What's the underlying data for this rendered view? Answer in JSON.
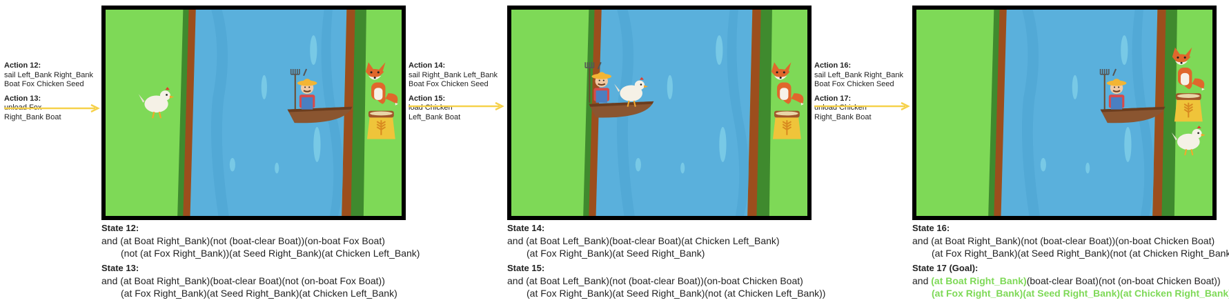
{
  "actions": [
    {
      "title": "Action 12:",
      "text": "sail Left_Bank Right_Bank\nBoat Fox Chicken Seed"
    },
    {
      "title": "Action 13:",
      "text": "unload Fox\nRight_Bank Boat"
    },
    {
      "title": "Action 14:",
      "text": "sail Right_Bank Left_Bank\nBoat Fox Chicken Seed"
    },
    {
      "title": "Action 15:",
      "text": "load Chicken\nLeft_Bank Boat"
    },
    {
      "title": "Action 16:",
      "text": "sail Left_Bank Right_Bank\nBoat Fox Chicken Seed"
    },
    {
      "title": "Action 17:",
      "text": "unload Chicken\nRight_Bank Boat"
    }
  ],
  "states": [
    {
      "title": "State 12:",
      "line1": "and (at Boat Right_Bank)(not (boat-clear Boat))(on-boat Fox Boat)",
      "line2": "(not (at Fox Right_Bank))(at Seed Right_Bank)(at Chicken Left_Bank)"
    },
    {
      "title": "State 13:",
      "line1": "and (at Boat Right_Bank)(boat-clear Boat)(not (on-boat Fox Boat))",
      "line2": "(at Fox Right_Bank)(at Seed Right_Bank)(at Chicken Left_Bank)"
    },
    {
      "title": "State 14:",
      "line1": "and (at Boat Left_Bank)(boat-clear Boat)(at Chicken Left_Bank)",
      "line2": "(at Fox Right_Bank)(at Seed Right_Bank)"
    },
    {
      "title": "State 15:",
      "line1": "and (at Boat Left_Bank)(not (boat-clear Boat))(on-boat Chicken Boat)",
      "line2": "(at Fox Right_Bank)(at Seed Right_Bank)(not (at Chicken Left_Bank))"
    },
    {
      "title": "State 16:",
      "line1": "and (at Boat Right_Bank)(not (boat-clear Boat))(on-boat Chicken Boat)",
      "line2": "(at Fox Right_Bank)(at Seed Right_Bank)(not (at Chicken Right_Bank))"
    },
    {
      "title": "State 17 (Goal):",
      "line1_prefix": "and ",
      "line1_goal": "(at Boat Right_Bank)",
      "line1_rest": "(boat-clear Boat)(not (on-boat Chicken Boat))",
      "line2_goal": "(at Fox Right_Bank)(at Seed Right_Bank)(at Chicken Right_Bank)"
    }
  ],
  "colors": {
    "grass": "#7ed957",
    "river": "#5ab0dc",
    "arrow": "#f6d14a",
    "goal": "#7ed957"
  },
  "icons": [
    "farmer-icon",
    "boat-icon",
    "fox-icon",
    "chicken-icon",
    "seed-bag-icon"
  ]
}
